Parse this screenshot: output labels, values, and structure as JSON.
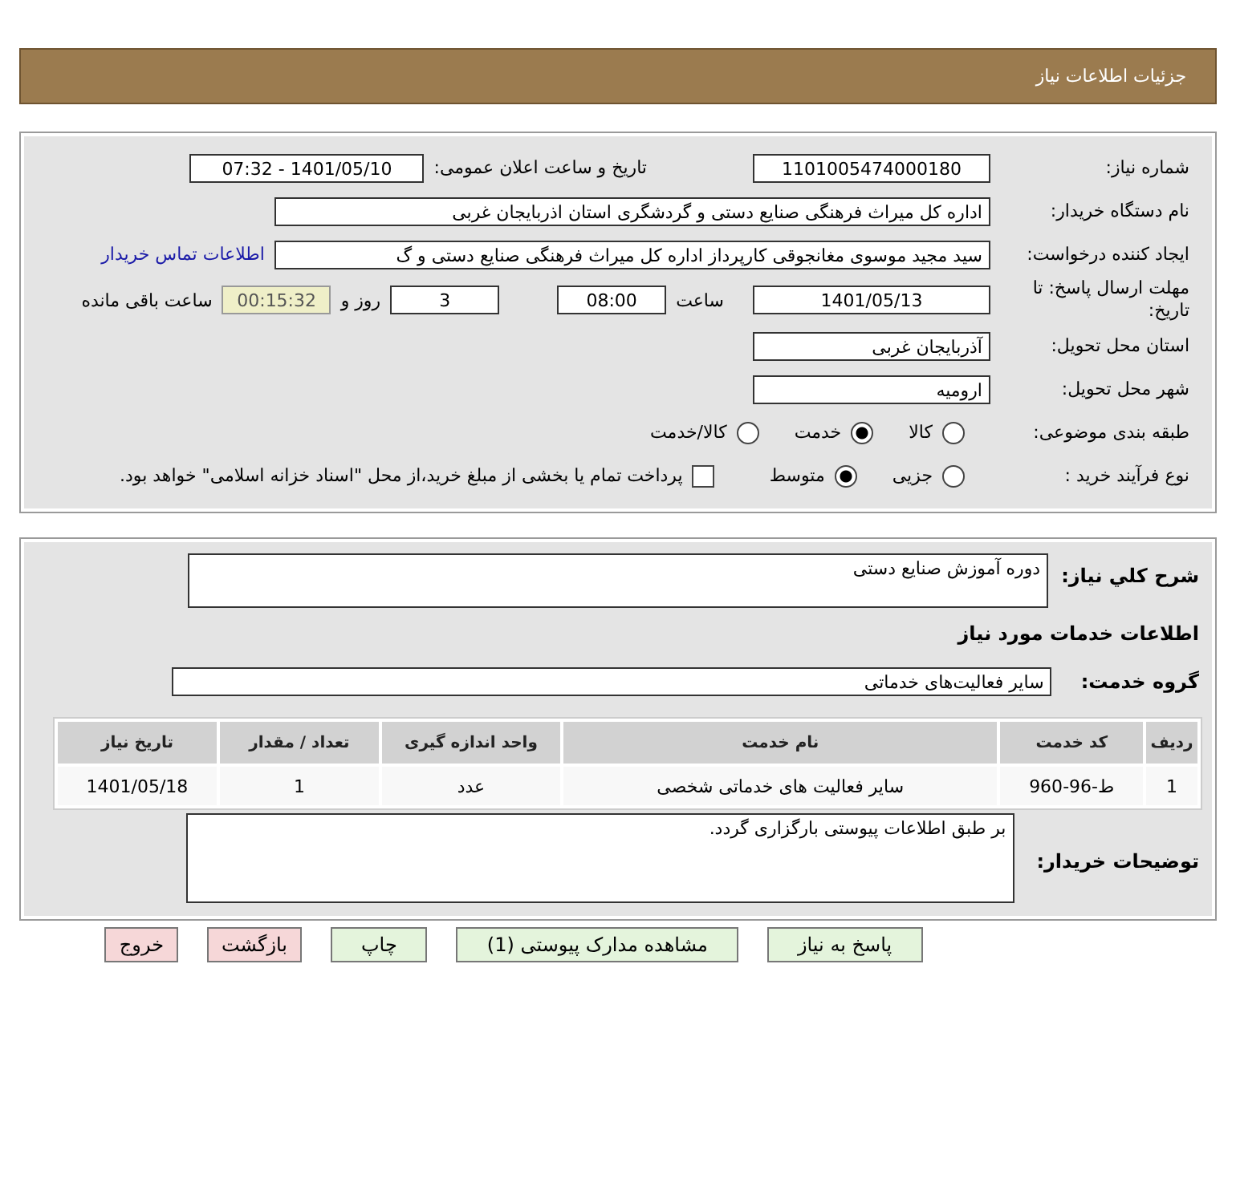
{
  "header": {
    "title": "جزئیات اطلاعات نیاز"
  },
  "details": {
    "need_number": {
      "label": "شماره نیاز:",
      "value": "1101005474000180"
    },
    "announce": {
      "label": "تاریخ و ساعت اعلان عمومی:",
      "value": "1401/05/10 - 07:32"
    },
    "buyer": {
      "label": "نام دستگاه خریدار:",
      "value": "اداره کل میراث فرهنگی  صنایع دستی و گردشگری استان اذربایجان غربی"
    },
    "requester": {
      "label": "ایجاد کننده درخواست:",
      "value": "سید مجید موسوی مغانجوقی کارپرداز اداره کل میراث فرهنگی  صنایع دستی و گ",
      "link": "اطلاعات تماس خریدار"
    },
    "deadline": {
      "label": "مهلت ارسال پاسخ: تا تاریخ:",
      "date": "1401/05/13",
      "time_label": "ساعت",
      "time": "08:00",
      "days": "3",
      "days_label": "روز و",
      "remaining": "00:15:32",
      "remaining_label": "ساعت باقی مانده"
    },
    "province": {
      "label": "استان محل تحویل:",
      "value": "آذربایجان غربی"
    },
    "city": {
      "label": "شهر محل تحویل:",
      "value": "ارومیه"
    },
    "category": {
      "label": "طبقه بندی موضوعی:",
      "options": [
        {
          "label": "کالا",
          "selected": false
        },
        {
          "label": "خدمت",
          "selected": true
        },
        {
          "label": "کالا/خدمت",
          "selected": false
        }
      ]
    },
    "process": {
      "label": "نوع فرآیند خرید :",
      "options": [
        {
          "label": "جزیی",
          "selected": false
        },
        {
          "label": "متوسط",
          "selected": true
        }
      ],
      "payment": {
        "label": "پرداخت تمام یا بخشی از مبلغ خرید،از محل \"اسناد خزانه اسلامی\" خواهد بود.",
        "checked": false
      }
    }
  },
  "summary": {
    "label": "شرح کلي نياز:",
    "value": "دوره آموزش صنایع دستی"
  },
  "services_heading": "اطلاعات خدمات مورد نیاز",
  "service_group": {
    "label": "گروه خدمت:",
    "value": "سایر فعالیت‌های خدماتی"
  },
  "table": {
    "columns": [
      "ردیف",
      "کد خدمت",
      "نام خدمت",
      "واحد اندازه گیری",
      "تعداد / مقدار",
      "تاریخ نیاز"
    ],
    "rows": [
      [
        "1",
        "ط-96-960",
        "سایر فعالیت های خدماتی شخصی",
        "عدد",
        "1",
        "1401/05/18"
      ]
    ]
  },
  "buyer_notes": {
    "label": "توضیحات خریدار:",
    "value": "بر طبق اطلاعات پیوستی بارگزاری گردد."
  },
  "buttons": [
    {
      "label": "پاسخ به نیاز",
      "kind": "primary"
    },
    {
      "label": "مشاهده مدارک پیوستی (1)",
      "kind": "primary"
    },
    {
      "label": "چاپ",
      "kind": "primary"
    },
    {
      "label": "بازگشت",
      "kind": "danger"
    },
    {
      "label": "خروج",
      "kind": "danger"
    }
  ]
}
